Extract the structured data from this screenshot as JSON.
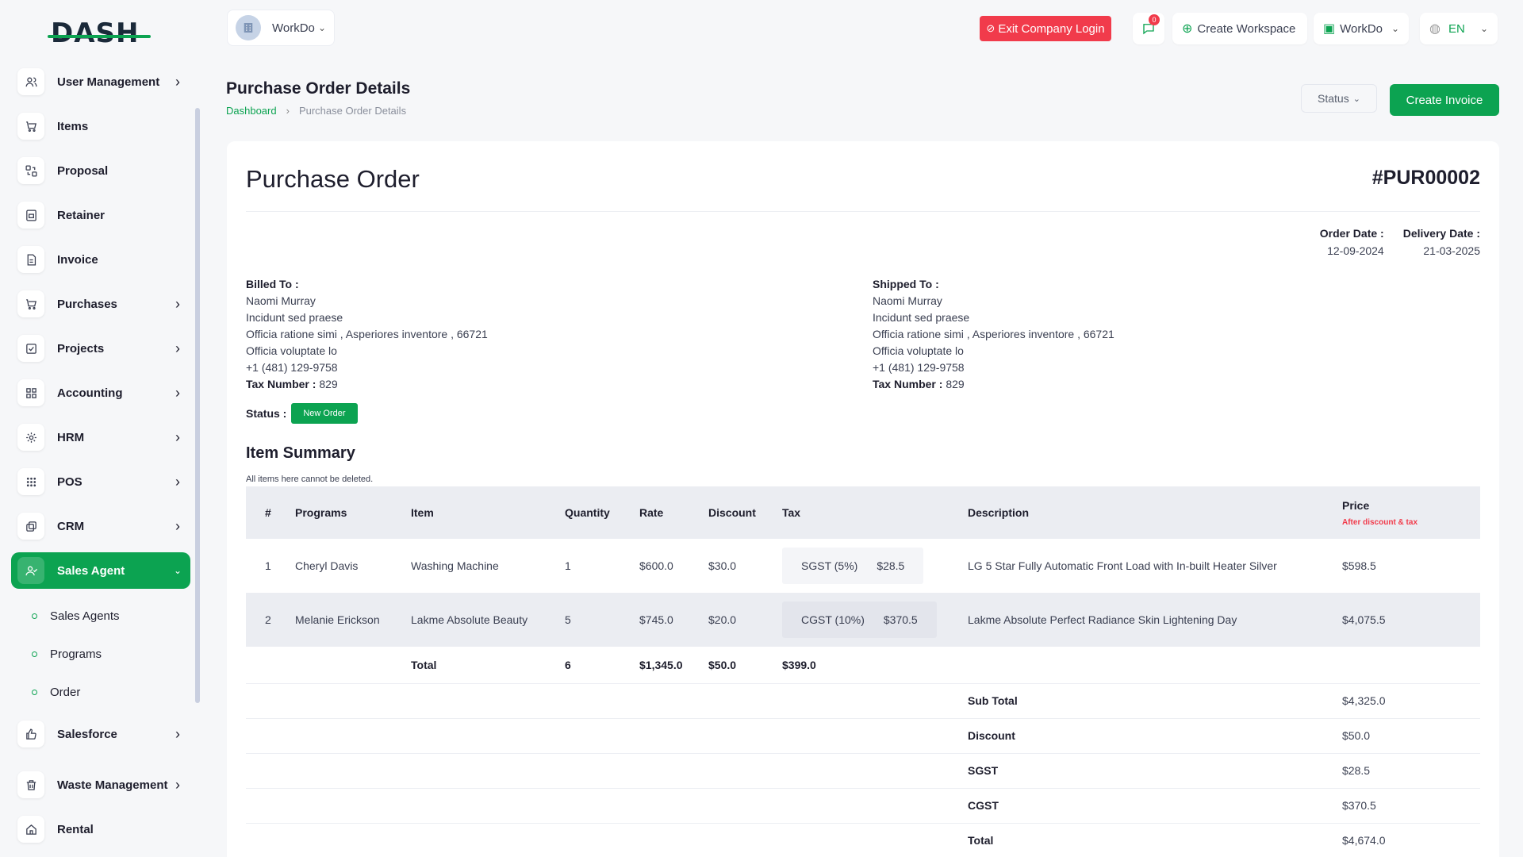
{
  "brand": {
    "logo": "DASH"
  },
  "sidebar": {
    "items": [
      {
        "label": "User Management",
        "icon": "users-icon",
        "chevron": true
      },
      {
        "label": "Items",
        "icon": "cart-icon",
        "chevron": false
      },
      {
        "label": "Proposal",
        "icon": "proposal-icon",
        "chevron": false
      },
      {
        "label": "Retainer",
        "icon": "retainer-icon",
        "chevron": false
      },
      {
        "label": "Invoice",
        "icon": "invoice-icon",
        "chevron": false
      },
      {
        "label": "Purchases",
        "icon": "cart-icon",
        "chevron": true
      },
      {
        "label": "Projects",
        "icon": "projects-icon",
        "chevron": true
      },
      {
        "label": "Accounting",
        "icon": "grid-icon",
        "chevron": true
      },
      {
        "label": "HRM",
        "icon": "hrm-icon",
        "chevron": true
      },
      {
        "label": "POS",
        "icon": "dots-grid-icon",
        "chevron": true
      },
      {
        "label": "CRM",
        "icon": "crm-icon",
        "chevron": true
      },
      {
        "label": "Sales Agent",
        "icon": "user-check-icon",
        "chevron": true,
        "active": true
      }
    ],
    "sub_items": [
      "Sales Agents",
      "Programs",
      "Order"
    ],
    "items_after": [
      {
        "label": "Salesforce",
        "icon": "thumbs-up-icon",
        "chevron": true
      },
      {
        "label": "Waste Management",
        "icon": "trash-icon",
        "chevron": true
      },
      {
        "label": "Rental",
        "icon": "home-icon",
        "chevron": false
      }
    ]
  },
  "header": {
    "workspace": "WorkDo",
    "exit_label": "Exit Company Login",
    "notif_count": "0",
    "create_workspace": "Create Workspace",
    "workdo_menu": "WorkDo",
    "language": "EN"
  },
  "page": {
    "title": "Purchase Order Details",
    "breadcrumb_home": "Dashboard",
    "breadcrumb_current": "Purchase Order Details",
    "status_dropdown": "Status",
    "create_invoice": "Create Invoice"
  },
  "order": {
    "heading": "Purchase Order",
    "number": "#PUR00002",
    "order_date_label": "Order Date :",
    "order_date": "12-09-2024",
    "delivery_date_label": "Delivery Date :",
    "delivery_date": "21-03-2025",
    "billed_label": "Billed To :",
    "shipped_label": "Shipped To :",
    "billed": {
      "name": "Naomi Murray",
      "line1": "Incidunt sed praese",
      "line2": "Officia ratione simi , Asperiores inventore , 66721",
      "line3": "Officia voluptate lo",
      "phone": "+1 (481) 129-9758",
      "tax_label": "Tax Number :",
      "tax": "829"
    },
    "shipped": {
      "name": "Naomi Murray",
      "line1": "Incidunt sed praese",
      "line2": "Officia ratione simi , Asperiores inventore , 66721",
      "line3": "Officia voluptate lo",
      "phone": "+1 (481) 129-9758",
      "tax_label": "Tax Number :",
      "tax": "829"
    },
    "status_label": "Status :",
    "status": "New Order"
  },
  "summary": {
    "title": "Item Summary",
    "note": "All items here cannot be deleted.",
    "columns": [
      "#",
      "Programs",
      "Item",
      "Quantity",
      "Rate",
      "Discount",
      "Tax",
      "Description",
      "Price"
    ],
    "price_sub": "After discount & tax",
    "rows": [
      {
        "num": "1",
        "program": "Cheryl Davis",
        "item": "Washing Machine",
        "qty": "1",
        "rate": "$600.0",
        "discount": "$30.0",
        "tax_name": "SGST (5%)",
        "tax_amount": "$28.5",
        "description": "LG  5 Star Fully Automatic Front Load with In-built Heater Silver",
        "price": "$598.5"
      },
      {
        "num": "2",
        "program": "Melanie Erickson",
        "item": "Lakme Absolute Beauty",
        "qty": "5",
        "rate": "$745.0",
        "discount": "$20.0",
        "tax_name": "CGST (10%)",
        "tax_amount": "$370.5",
        "description": "Lakme Absolute Perfect Radiance Skin Lightening Day",
        "price": "$4,075.5"
      }
    ],
    "total_label": "Total",
    "total_qty": "6",
    "total_rate": "$1,345.0",
    "total_discount": "$50.0",
    "total_tax": "$399.0",
    "totals": [
      {
        "label": "Sub Total",
        "value": "$4,325.0"
      },
      {
        "label": "Discount",
        "value": "$50.0"
      },
      {
        "label": "SGST",
        "value": "$28.5"
      },
      {
        "label": "CGST",
        "value": "$370.5"
      },
      {
        "label": "Total",
        "value": "$4,674.0"
      }
    ]
  },
  "colors": {
    "accent": "#0ca351",
    "danger": "#f13b4b",
    "bg": "#f6f7f9"
  }
}
